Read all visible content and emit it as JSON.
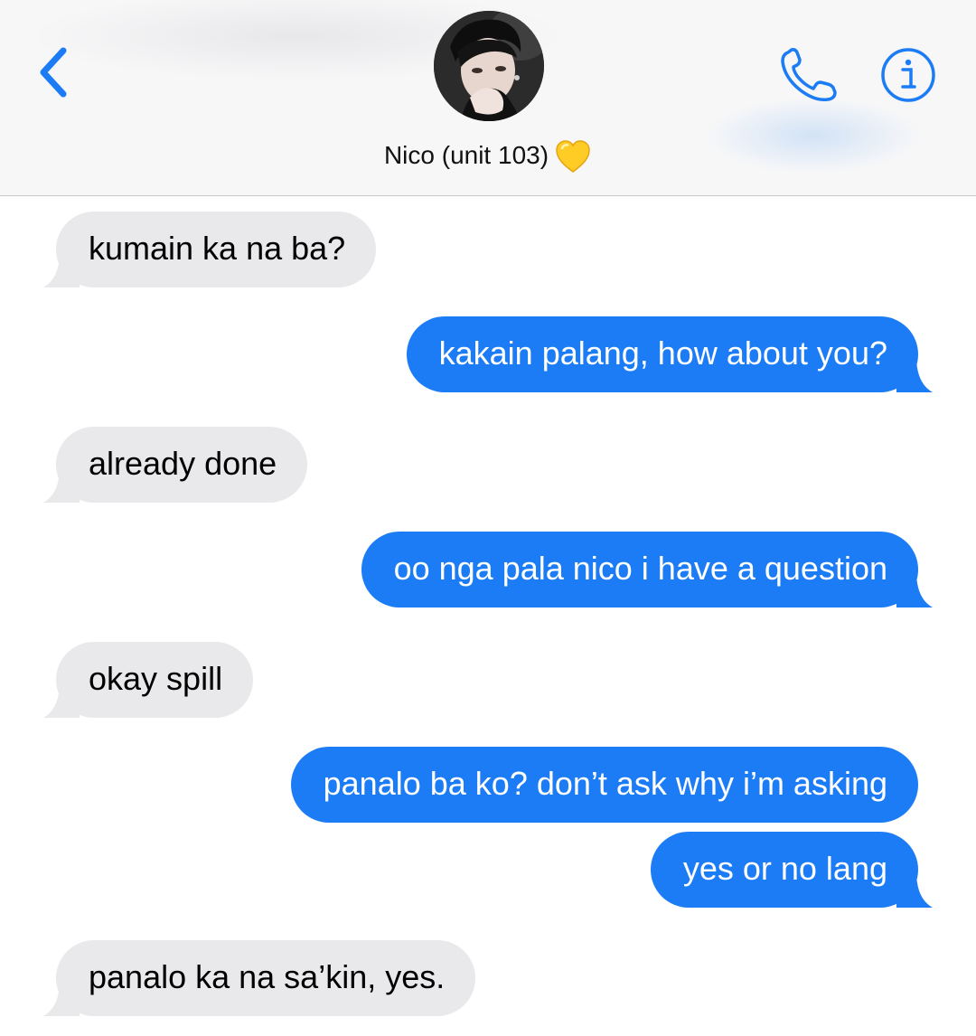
{
  "header": {
    "contact_name": "Nico (unit 103)",
    "heart_emoji": "💛",
    "back_icon": "chevron-left-icon",
    "call_icon": "phone-icon",
    "info_icon": "info-icon",
    "accent_color": "#1b7cf5"
  },
  "messages": [
    {
      "direction": "incoming",
      "text": "kumain ka na ba?"
    },
    {
      "direction": "outgoing",
      "text": "kakain palang, how about you?"
    },
    {
      "direction": "incoming",
      "text": "already done"
    },
    {
      "direction": "outgoing",
      "text": "oo nga pala nico i have a question"
    },
    {
      "direction": "incoming",
      "text": "okay spill"
    },
    {
      "direction": "outgoing",
      "text": "panalo ba ko? don’t ask why i’m asking"
    },
    {
      "direction": "outgoing",
      "text": "yes or no lang"
    },
    {
      "direction": "incoming",
      "text": "panalo ka na sa’kin, yes."
    }
  ],
  "colors": {
    "incoming_bubble": "#e9e9eb",
    "outgoing_bubble": "#1b7cf5"
  }
}
